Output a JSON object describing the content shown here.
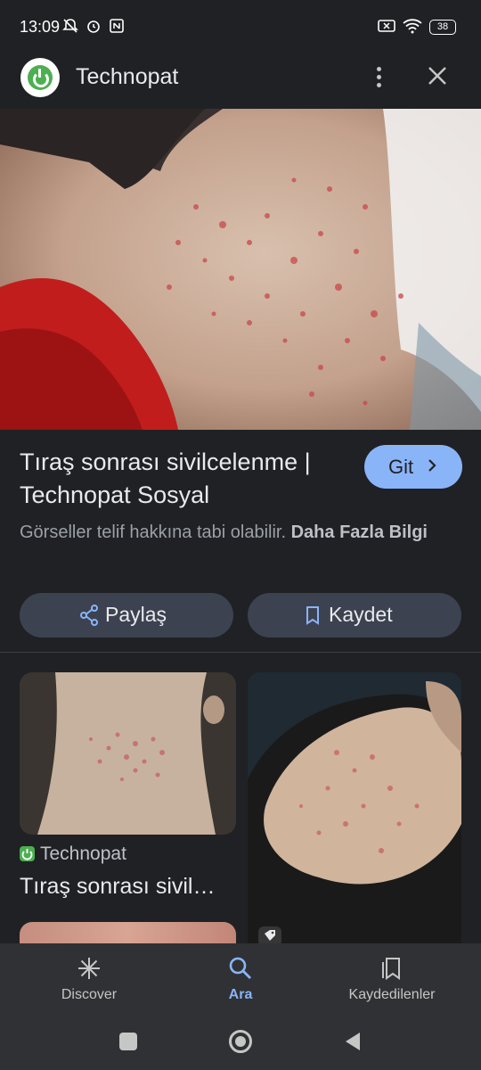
{
  "status_bar": {
    "time": "13:09",
    "battery": "38",
    "icons": [
      "mute-bell-icon",
      "alarm-icon",
      "nfc-icon",
      "sim-off-icon",
      "wifi-icon",
      "battery-icon"
    ]
  },
  "header": {
    "site_name": "Technopat",
    "menu_icon": "more-vert-icon",
    "close_icon": "close-icon"
  },
  "result": {
    "title": "Tıraş sonrası sivilcelenme | Technopat Sosyal",
    "go_label": "Git",
    "copyright_text": "Görseller telif hakkına tabi olabilir.",
    "more_info_link": "Daha Fazla Bilgi",
    "share_label": "Paylaş",
    "save_label": "Kaydet"
  },
  "related": [
    {
      "source": "Technopat",
      "title": "Tıraş sonrası sivil…"
    }
  ],
  "bottom_nav": {
    "items": [
      {
        "label": "Discover",
        "icon": "asterisk-icon",
        "active": false
      },
      {
        "label": "Ara",
        "icon": "search-icon",
        "active": true
      },
      {
        "label": "Kaydedilenler",
        "icon": "bookmarks-icon",
        "active": false
      }
    ]
  },
  "colors": {
    "background": "#202124",
    "accent": "#8ab4f8",
    "button_bg": "#3c4250",
    "nav_bg": "#303134"
  }
}
